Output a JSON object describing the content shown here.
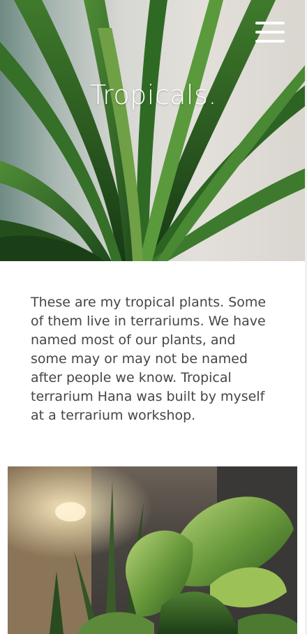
{
  "hero": {
    "title": "Tropicals.",
    "image_alt": "dracaena-plant-photo"
  },
  "nav": {
    "menu_icon": "hamburger-menu-icon"
  },
  "intro": {
    "text": "These are my tropical plants. Some of them live in terrariums. We have named most of our plants, and some may or may not be named after people we know. Tropical terrarium Hana was built by myself at a terrarium workshop."
  },
  "gallery": {
    "image_alt": "terrarium-plant-photo"
  },
  "colors": {
    "text": "#454545",
    "heading": "#ffffff",
    "leaf_dark": "#1f4a1c",
    "leaf_light": "#6fa046"
  }
}
